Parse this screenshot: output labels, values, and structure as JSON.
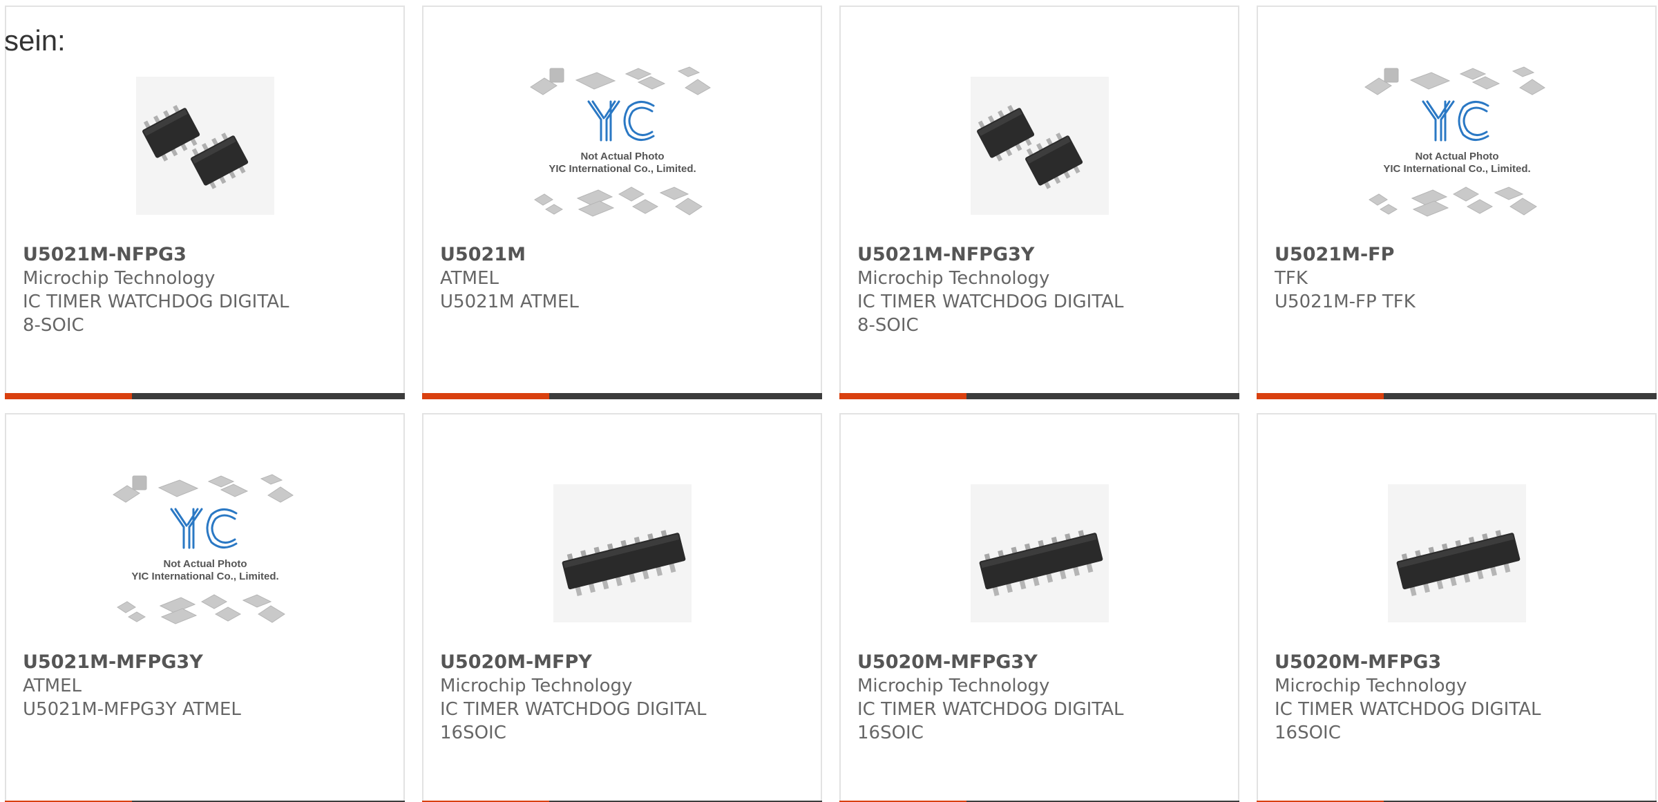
{
  "intro_text": "sein:",
  "colors": {
    "accent": "#d9400f",
    "bar": "#3c3c3c",
    "yic_blue": "#2a78c4"
  },
  "placeholder": {
    "line1": "Not Actual Photo",
    "line2": "YIC International Co., Limited.",
    "logo": "YIC"
  },
  "products": [
    {
      "part": "U5021M-NFPG3",
      "maker": "Microchip Technology",
      "desc1": "IC TIMER WATCHDOG DIGITAL",
      "desc2": "8-SOIC",
      "image": "soic8-pair-icon"
    },
    {
      "part": "U5021M",
      "maker": "ATMEL",
      "desc1": "U5021M ATMEL",
      "desc2": "",
      "image": "yic-placeholder-icon"
    },
    {
      "part": "U5021M-NFPG3Y",
      "maker": "Microchip Technology",
      "desc1": "IC TIMER WATCHDOG DIGITAL",
      "desc2": "8-SOIC",
      "image": "soic8-pair-icon"
    },
    {
      "part": "U5021M-FP",
      "maker": "TFK",
      "desc1": "U5021M-FP TFK",
      "desc2": "",
      "image": "yic-placeholder-icon"
    },
    {
      "part": "U5021M-MFPG3Y",
      "maker": "ATMEL",
      "desc1": "U5021M-MFPG3Y ATMEL",
      "desc2": "",
      "image": "yic-placeholder-icon"
    },
    {
      "part": "U5020M-MFPY",
      "maker": "Microchip Technology",
      "desc1": "IC TIMER WATCHDOG DIGITAL",
      "desc2": "16SOIC",
      "image": "soic16-icon"
    },
    {
      "part": "U5020M-MFPG3Y",
      "maker": "Microchip Technology",
      "desc1": "IC TIMER WATCHDOG DIGITAL",
      "desc2": "16SOIC",
      "image": "soic16-icon"
    },
    {
      "part": "U5020M-MFPG3",
      "maker": "Microchip Technology",
      "desc1": "IC TIMER WATCHDOG DIGITAL",
      "desc2": "16SOIC",
      "image": "soic16-icon"
    }
  ]
}
